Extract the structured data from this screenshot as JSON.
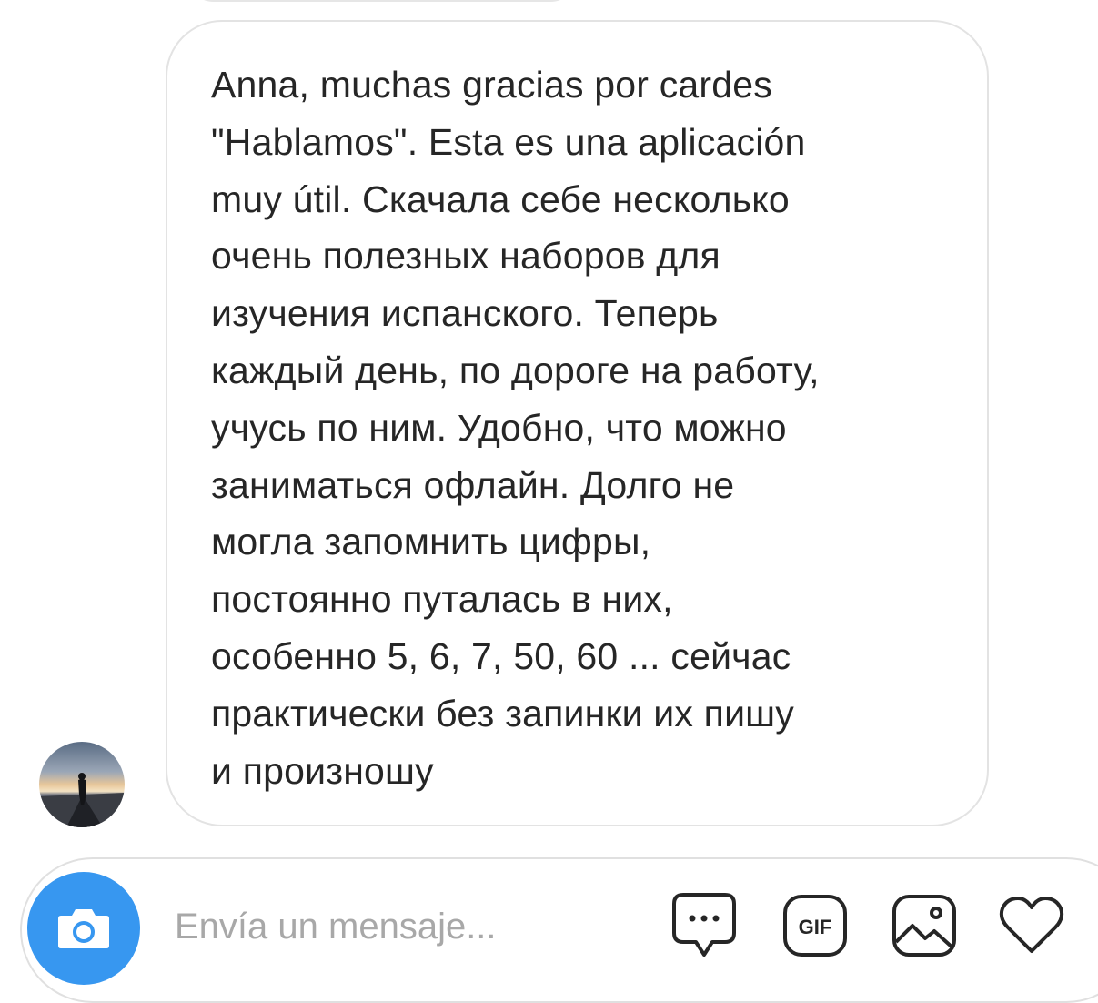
{
  "thread": {
    "message": {
      "text": "Anna, muchas gracias por cardes\n\"Hablamos\". Esta es una aplicación\nmuy útil. Скачала себе несколько\nочень полезных наборов для\nизучения испанского. Теперь\nкаждый день, по дороге на работу,\nучусь по ним. Удобно, что можно\nзаниматься офлайн. Долго не\nмогла запомнить цифры,\nпостоянно путалась в них,\nособенно 5, 6, 7, 50, 60 ... сейчас\nпрактически без запинки их пишу\nи произношу"
    }
  },
  "composer": {
    "placeholder": "Envía un mensaje...",
    "value": "",
    "gif_label": "GIF",
    "icons": [
      "camera-icon",
      "more-icon",
      "gif-icon",
      "photo-icon",
      "heart-icon"
    ]
  },
  "colors": {
    "accent": "#3797f0",
    "text": "#262626",
    "placeholder": "#a8a8a8",
    "border": "#e3e3e3"
  }
}
